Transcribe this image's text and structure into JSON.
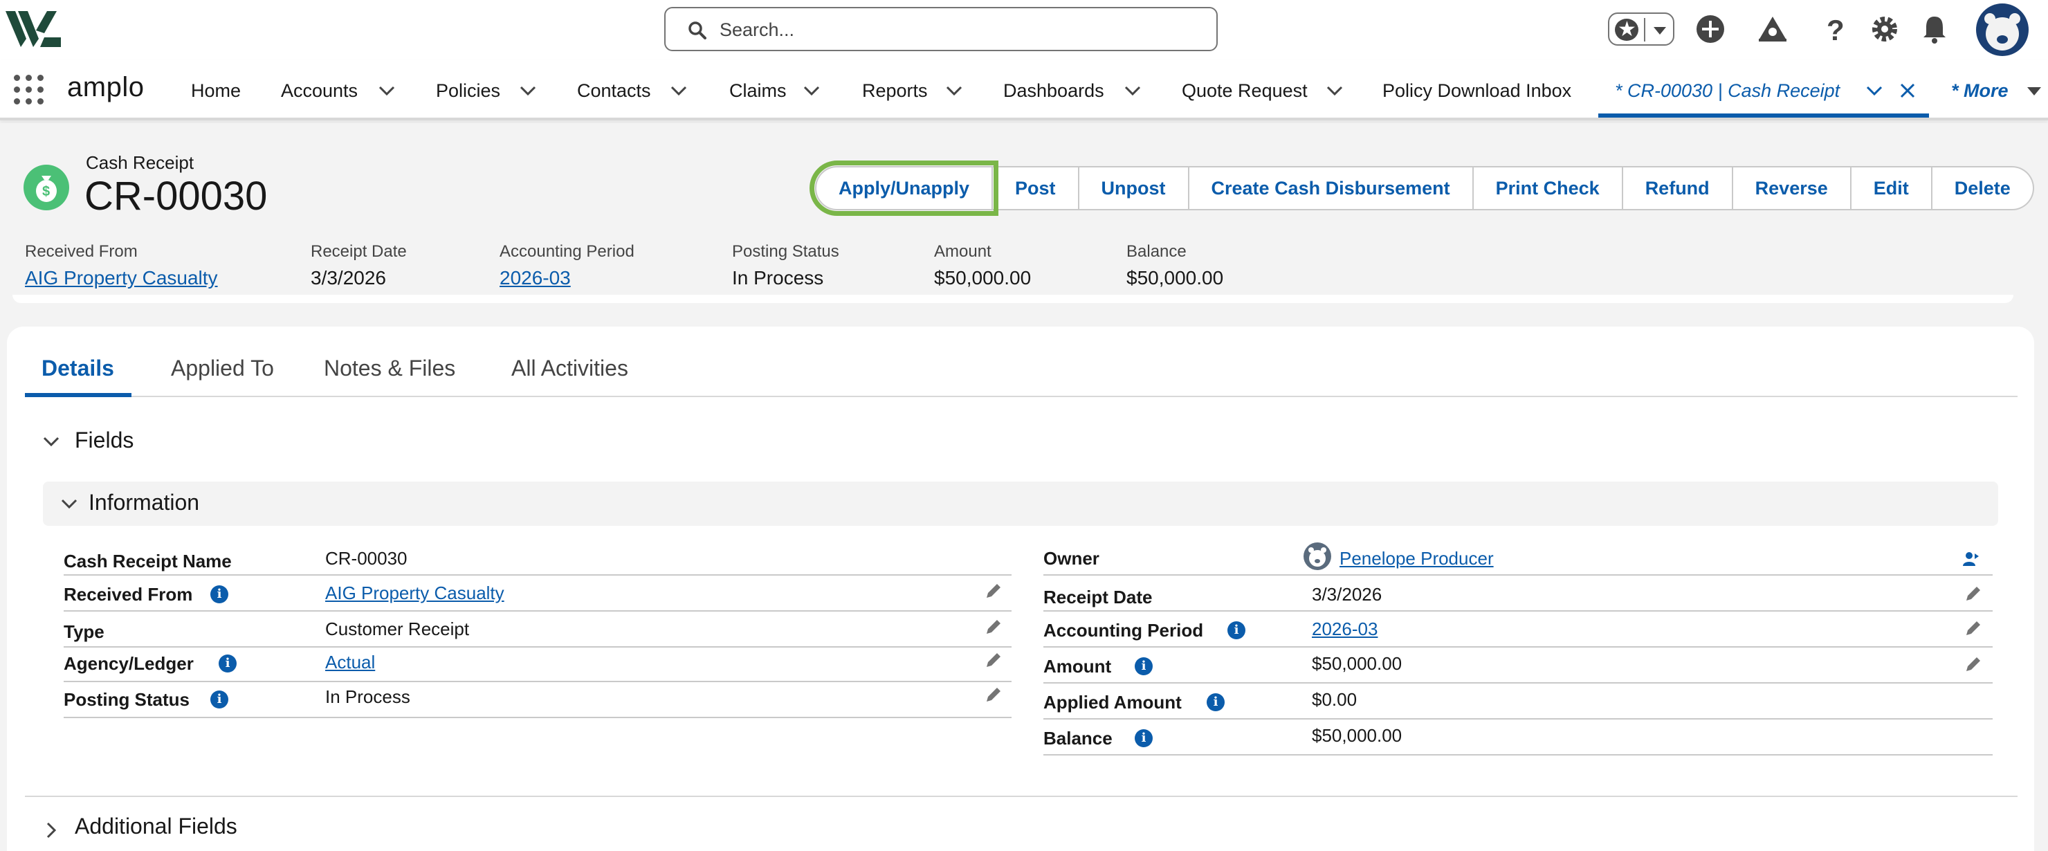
{
  "header": {
    "search_placeholder": "Search...",
    "icons": [
      "star-icon",
      "plus-circle-icon",
      "trailhead-icon",
      "help-icon",
      "gear-icon",
      "bell-icon",
      "avatar"
    ]
  },
  "nav": {
    "app_name": "amplo",
    "items": [
      "Home",
      "Accounts",
      "Policies",
      "Contacts",
      "Claims",
      "Reports",
      "Dashboards",
      "Quote Request",
      "Policy Download Inbox"
    ],
    "active_tab": "* CR-00030 | Cash Receipt",
    "more": "* More"
  },
  "record": {
    "type": "Cash Receipt",
    "name": "CR-00030",
    "actions": [
      "Apply/Unapply",
      "Post",
      "Unpost",
      "Create Cash Disbursement",
      "Print Check",
      "Refund",
      "Reverse",
      "Edit",
      "Delete"
    ],
    "highlights": [
      {
        "label": "Received From",
        "value": "AIG Property Casualty"
      },
      {
        "label": "Receipt Date",
        "value": "3/3/2026"
      },
      {
        "label": "Accounting Period",
        "value": "2026-03"
      },
      {
        "label": "Posting Status",
        "value": "In Process"
      },
      {
        "label": "Amount",
        "value": "$50,000.00"
      },
      {
        "label": "Balance",
        "value": "$50,000.00"
      }
    ]
  },
  "tabs": [
    "Details",
    "Applied To",
    "Notes & Files",
    "All Activities"
  ],
  "sections": {
    "fields": "Fields",
    "information": "Information",
    "additional": "Additional Fields"
  },
  "left_fields": [
    {
      "label": "Cash Receipt Name",
      "value": "CR-00030"
    },
    {
      "label": "Received From",
      "value": "AIG Property Casualty"
    },
    {
      "label": "Type",
      "value": "Customer Receipt"
    },
    {
      "label": "Agency/Ledger",
      "value": "Actual"
    },
    {
      "label": "Posting Status",
      "value": "In Process"
    }
  ],
  "right_fields": [
    {
      "label": "Owner",
      "value": "Penelope Producer"
    },
    {
      "label": "Receipt Date",
      "value": "3/3/2026"
    },
    {
      "label": "Accounting Period",
      "value": "2026-03"
    },
    {
      "label": "Amount",
      "value": "$50,000.00"
    },
    {
      "label": "Applied Amount",
      "value": "$0.00"
    },
    {
      "label": "Balance",
      "value": "$50,000.00"
    }
  ],
  "colors": {
    "brand_blue": "#0b5cab",
    "accent_green": "#7ab648",
    "record_icon": "#4bc076"
  }
}
